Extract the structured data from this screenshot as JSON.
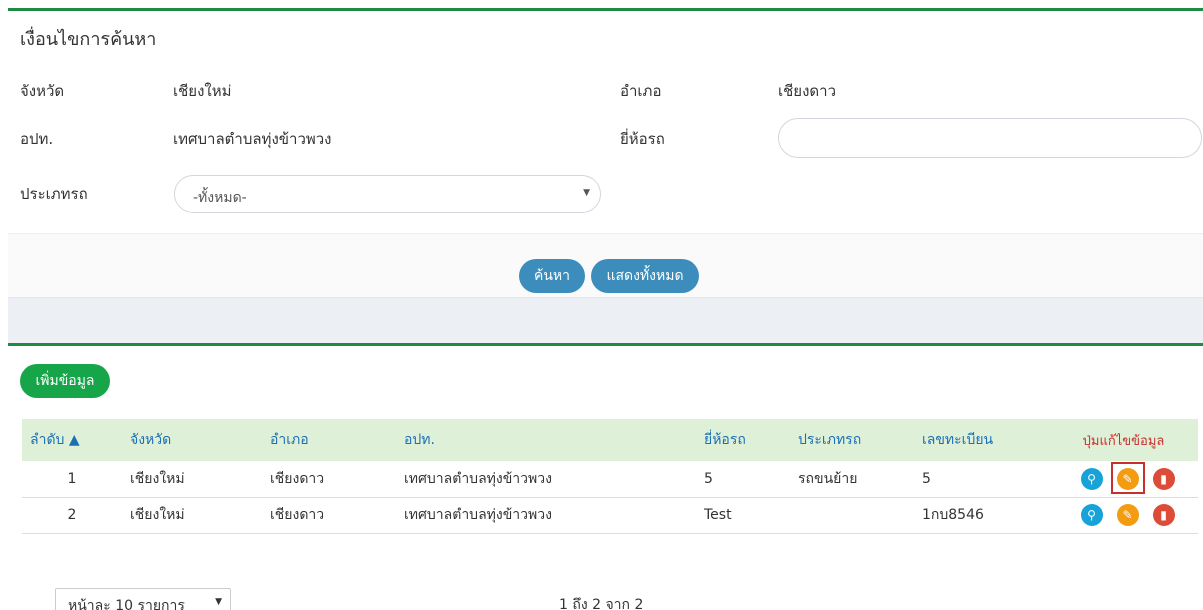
{
  "search": {
    "title": "เงื่อนไขการค้นหา",
    "province_label": "จังหวัด",
    "province_value": "เชียงใหม่",
    "district_label": "อำเภอ",
    "district_value": "เชียงดาว",
    "org_label": "อปท.",
    "org_value": "เทศบาลตำบลทุ่งข้าวพวง",
    "brand_label": "ยี่ห้อรถ",
    "brand_value": "",
    "type_label": "ประเภทรถ",
    "type_value": "-ทั้งหมด-",
    "search_button": "ค้นหา",
    "show_all_button": "แสดงทั้งหมด"
  },
  "list": {
    "add_button": "เพิ่มข้อมูล",
    "columns": [
      "ลำดับ ▲",
      "จังหวัด",
      "อำเภอ",
      "อปท.",
      "ยี่ห้อรถ",
      "ประเภทรถ",
      "เลขทะเบียน",
      "ปุ่มแก้ไขข้อมูล"
    ],
    "rows": [
      {
        "no": "1",
        "province": "เชียงใหม่",
        "district": "เชียงดาว",
        "org": "เทศบาลตำบลทุ่งข้าวพวง",
        "brand": "5",
        "type": "รถขนย้าย",
        "plate": "5"
      },
      {
        "no": "2",
        "province": "เชียงใหม่",
        "district": "เชียงดาว",
        "org": "เทศบาลตำบลทุ่งข้าวพวง",
        "brand": "Test",
        "type": "",
        "plate": "1กบ8546"
      }
    ],
    "page_size": "หน้าละ 10 รายการ",
    "page_info": "1 ถึง 2 จาก 2"
  },
  "colors": {
    "accent_green": "#1e8a43",
    "button_blue": "#3c8dbc",
    "header_bg": "#dff0d8",
    "header_text": "#1b6fb5",
    "action_label": "#c9302c"
  },
  "icons": [
    "search-icon",
    "edit-icon",
    "trash-icon"
  ]
}
